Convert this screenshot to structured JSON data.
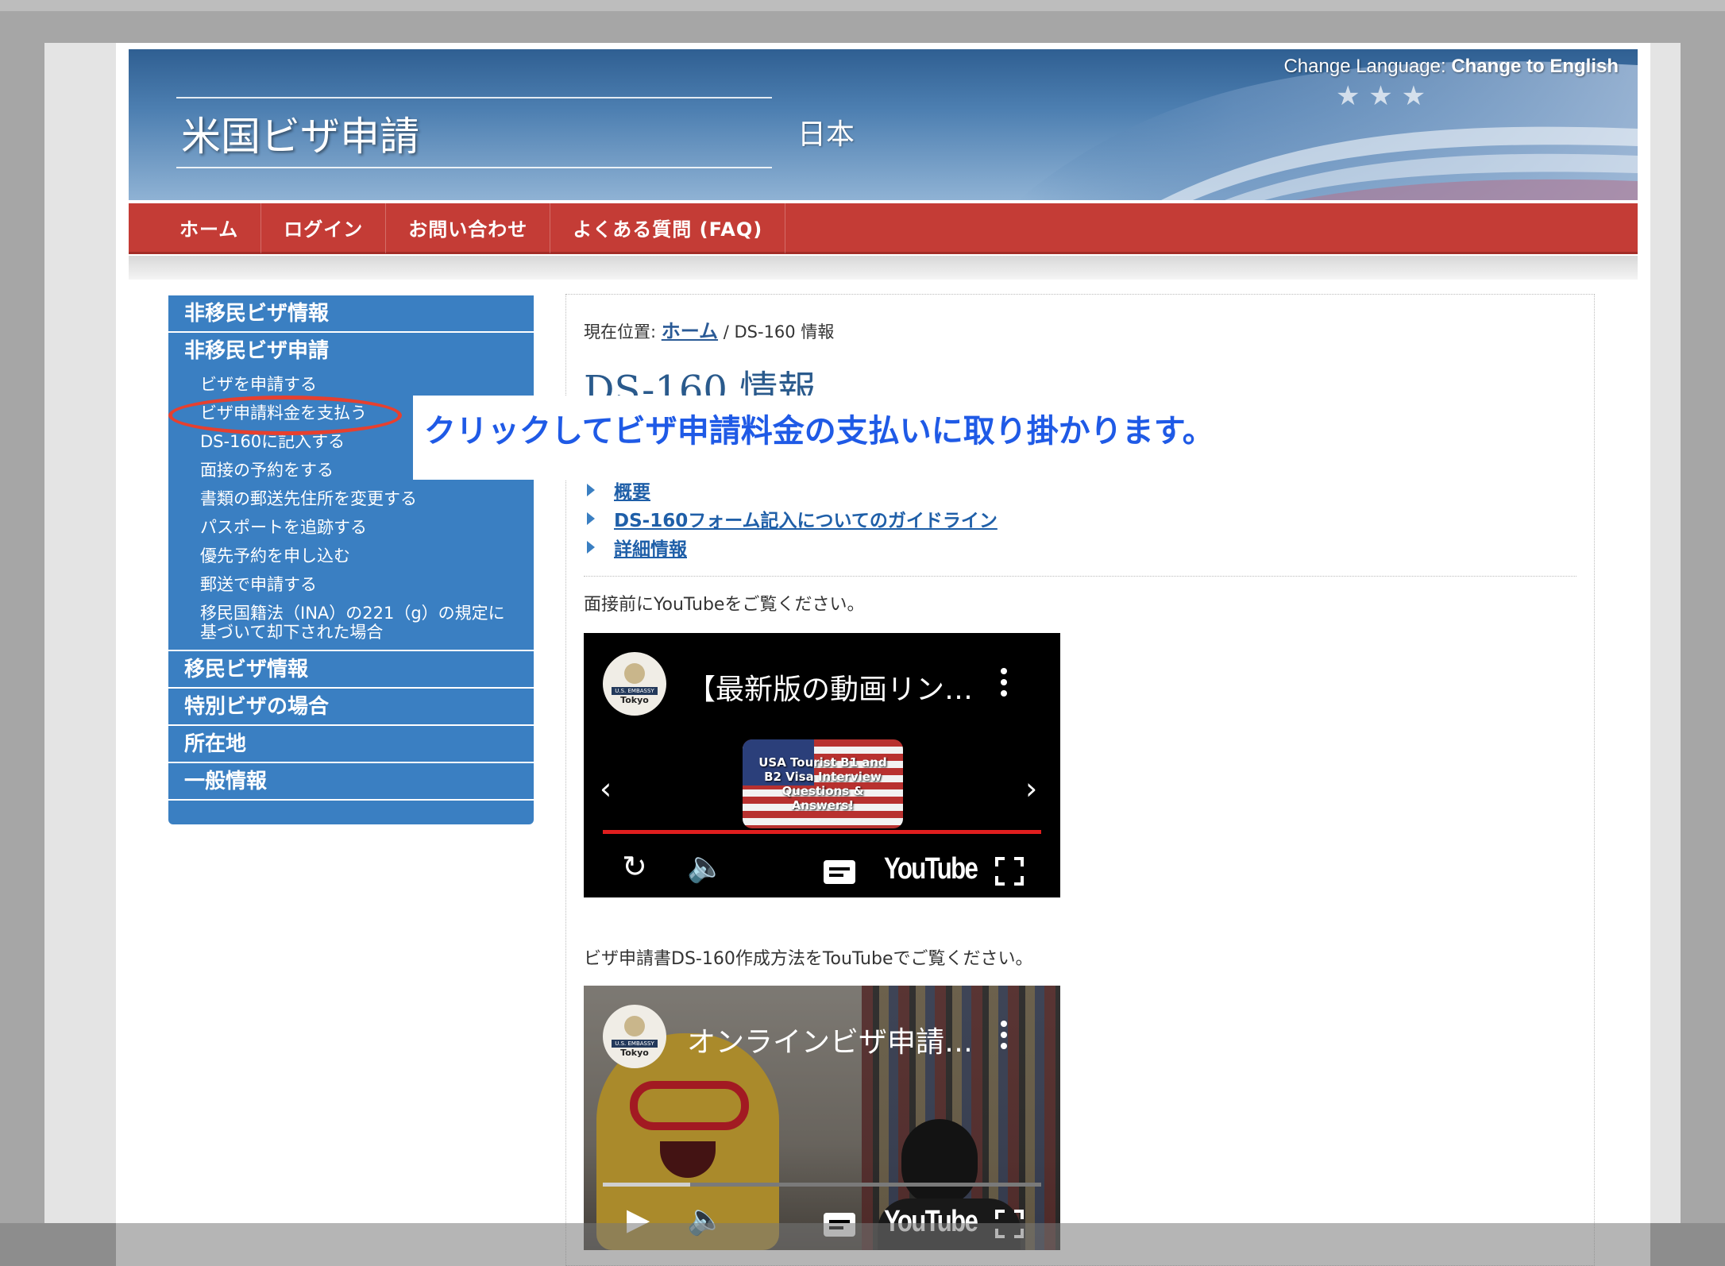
{
  "header": {
    "site_title": "米国ビザ申請",
    "country": "日本",
    "lang_label": "Change Language:",
    "lang_link": "Change to English"
  },
  "nav": {
    "items": [
      "ホーム",
      "ログイン",
      "お問い合わせ",
      "よくある質問 (FAQ)"
    ]
  },
  "sidebar": {
    "nonimmigrant_info": "非移民ビザ情報",
    "nonimmigrant_apply": "非移民ビザ申請",
    "sub_items": [
      "ビザを申請する",
      "ビザ申請料金を支払う",
      "DS-160に記入する",
      "面接の予約をする",
      "書類の郵送先住所を変更する",
      "パスポートを追跡する",
      "優先予約を申し込む",
      "郵送で申請する",
      "移民国籍法（INA）の221（g）の規定に",
      "基づいて却下された場合"
    ],
    "immigrant_info": "移民ビザ情報",
    "special_visa": "特別ビザの場合",
    "locations": "所在地",
    "general_info": "一般情報"
  },
  "annotation": {
    "callout": "クリックしてビザ申請料金の支払いに取り掛かります。"
  },
  "main": {
    "breadcrumb_prefix": "現在位置:",
    "breadcrumb_home": "ホーム",
    "breadcrumb_current": "/ DS-160 情報",
    "title": "DS-160 情報",
    "toc": [
      "概要",
      "DS-160フォーム記入についてのガイドライン",
      "詳細情報"
    ],
    "caption1": "面接前にYouTubeをご覧ください。",
    "caption2": "ビザ申請書DS-160作成方法をTouTubeでご覧ください。"
  },
  "video1": {
    "channel_emb": "U.S. EMBASSY",
    "channel_city": "Tokyo",
    "title": "【最新版の動画リン…",
    "thumb_text": "USA Tourist B1 and B2 Visa Interview Questions & Answers!",
    "brand": "YouTube",
    "progress": 1.0
  },
  "video2": {
    "channel_emb": "U.S. EMBASSY",
    "channel_city": "Tokyo",
    "title": "オンラインビザ申請…",
    "brand": "YouTube",
    "progress": 0.2
  },
  "colors": {
    "nav_red": "#c43c36",
    "sidebar_blue": "#3a7fc2",
    "title_blue": "#2a5a8c",
    "callout_blue": "#1f5ae6",
    "oval_red": "#e6402f"
  },
  "icons": {
    "prev": "chevron-left-icon",
    "next": "chevron-right-icon",
    "replay": "replay-icon",
    "play": "play-icon",
    "volume": "volume-icon",
    "captions": "captions-icon",
    "fullscreen": "fullscreen-icon",
    "more": "more-vertical-icon"
  }
}
